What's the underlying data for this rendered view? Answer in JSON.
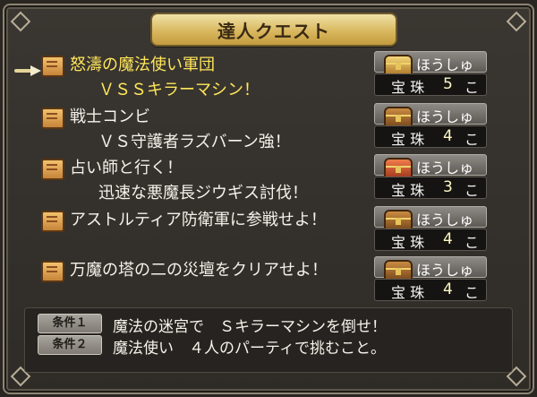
{
  "window": {
    "title": "達人クエスト"
  },
  "quests": [
    {
      "title": "怒濤の魔法使い軍団",
      "subtitle": "ＶＳＳキラーマシン！",
      "reward_label": "ほうしゅう",
      "reward_item": "宝 珠",
      "reward_count": "5",
      "reward_unit": "こ",
      "selected": true
    },
    {
      "title": "戦士コンビ",
      "subtitle": "ＶＳ守護者ラズバーン強！",
      "reward_label": "ほうしゅう",
      "reward_item": "宝 珠",
      "reward_count": "4",
      "reward_unit": "こ",
      "selected": false
    },
    {
      "title": "占い師と行く！",
      "subtitle": "迅速な悪魔長ジウギス討伐！",
      "reward_label": "ほうしゅう",
      "reward_item": "宝 珠",
      "reward_count": "3",
      "reward_unit": "こ",
      "selected": false
    },
    {
      "title": "アストルティア防衛軍に参戦せよ！",
      "subtitle": "",
      "reward_label": "ほうしゅう",
      "reward_item": "宝 珠",
      "reward_count": "4",
      "reward_unit": "こ",
      "selected": false
    },
    {
      "title": "万魔の塔の二の災壇をクリアせよ！",
      "subtitle": "",
      "reward_label": "ほうしゅう",
      "reward_item": "宝 珠",
      "reward_count": "4",
      "reward_unit": "こ",
      "selected": false
    }
  ],
  "conditions": [
    {
      "label": "条件１",
      "text": "魔法の迷宮で　Ｓキラーマシンを倒せ！"
    },
    {
      "label": "条件２",
      "text": "魔法使い　４人のパーティで挑むこと。"
    }
  ],
  "icons": {
    "cursor": "pointer-icon",
    "quest": "scroll-icon",
    "reward": "treasure-chest-icon"
  },
  "colors": {
    "selected_text": "#ffe65a",
    "normal_text": "#f4f2ea",
    "panel": "#2f2c28"
  }
}
